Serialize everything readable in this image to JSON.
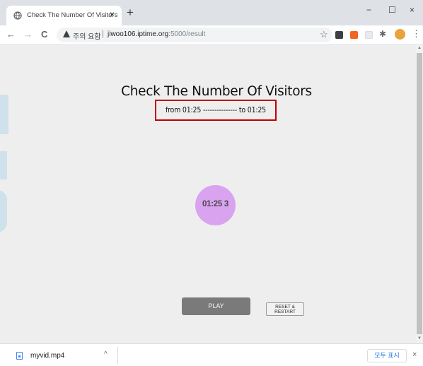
{
  "tab": {
    "title": "Check The Number Of Visitors",
    "close_glyph": "×",
    "favicon": "globe-icon"
  },
  "new_tab_glyph": "+",
  "window_controls": {
    "minimize": "−",
    "maximize": "☐",
    "close": "×"
  },
  "nav": {
    "back": "←",
    "forward": "→",
    "reload": "C"
  },
  "omnibox": {
    "security_label": "주의 요함",
    "separator": "|",
    "host": "jiwoo106.iptime.org",
    "path": ":5000/result"
  },
  "toolbar_icons": {
    "bookmark": "☆",
    "extensions": "✱",
    "menu": "⋮"
  },
  "page": {
    "title": "Check The Number Of Visitors",
    "range_text": "from 01:25 --------------- to 01:25",
    "count_text": "01:25 3",
    "play_label": "PLAY",
    "reset_label_line1": "RESET &",
    "reset_label_line2": "RESTART"
  },
  "download_shelf": {
    "file_name": "myvid.mp4",
    "chevron": "^",
    "show_all_label": "모두 표시",
    "close_glyph": "×"
  },
  "colors": {
    "tab_strip": "#dee1e6",
    "page_bg": "#eeeeee",
    "highlight_border": "#c00000",
    "counter_circle": "#d9a3f0",
    "play_button": "#7a7a7a",
    "show_all_text": "#1a73e8"
  }
}
